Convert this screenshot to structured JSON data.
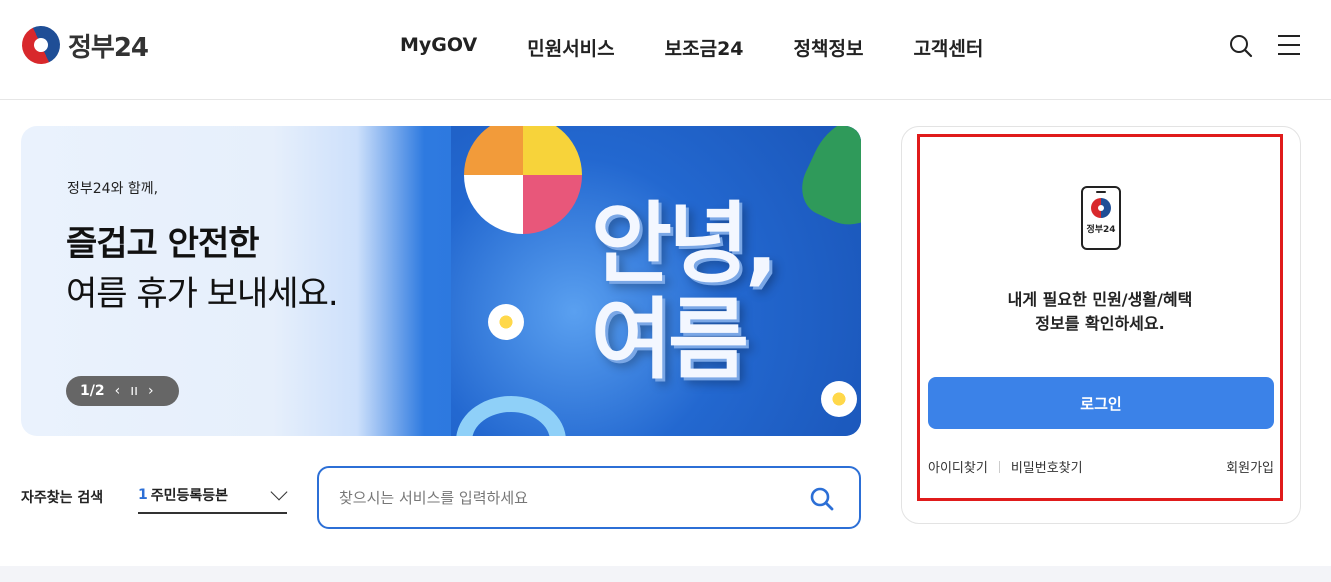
{
  "header": {
    "logo_text": "정부24",
    "nav": [
      "MyGOV",
      "민원서비스",
      "보조금24",
      "정책정보",
      "고객센터"
    ]
  },
  "banner": {
    "small_text": "정부24와 함께,",
    "title_line1": "즐겁고 안전한",
    "title_line2": "여름 휴가 보내세요.",
    "art_text_line1": "안녕,",
    "art_text_line2": "여름",
    "pager": {
      "count": "1/2",
      "prev": "‹",
      "pause": "ıı",
      "next": "›"
    }
  },
  "quick_search": {
    "label": "자주찾는 검색",
    "selected_num": "1",
    "selected_text": "주민등록등본"
  },
  "search": {
    "placeholder": "찾으시는 서비스를 입력하세요"
  },
  "login": {
    "phone_label": "정부24",
    "message_line1": "내게 필요한 민원/생활/혜택",
    "message_line2": "정보를 확인하세요.",
    "button": "로그인",
    "find_id": "아이디찾기",
    "find_pw": "비밀번호찾기",
    "signup": "회원가입"
  },
  "colors": {
    "accent": "#3b82e8",
    "highlight_frame": "#e01b1b"
  }
}
